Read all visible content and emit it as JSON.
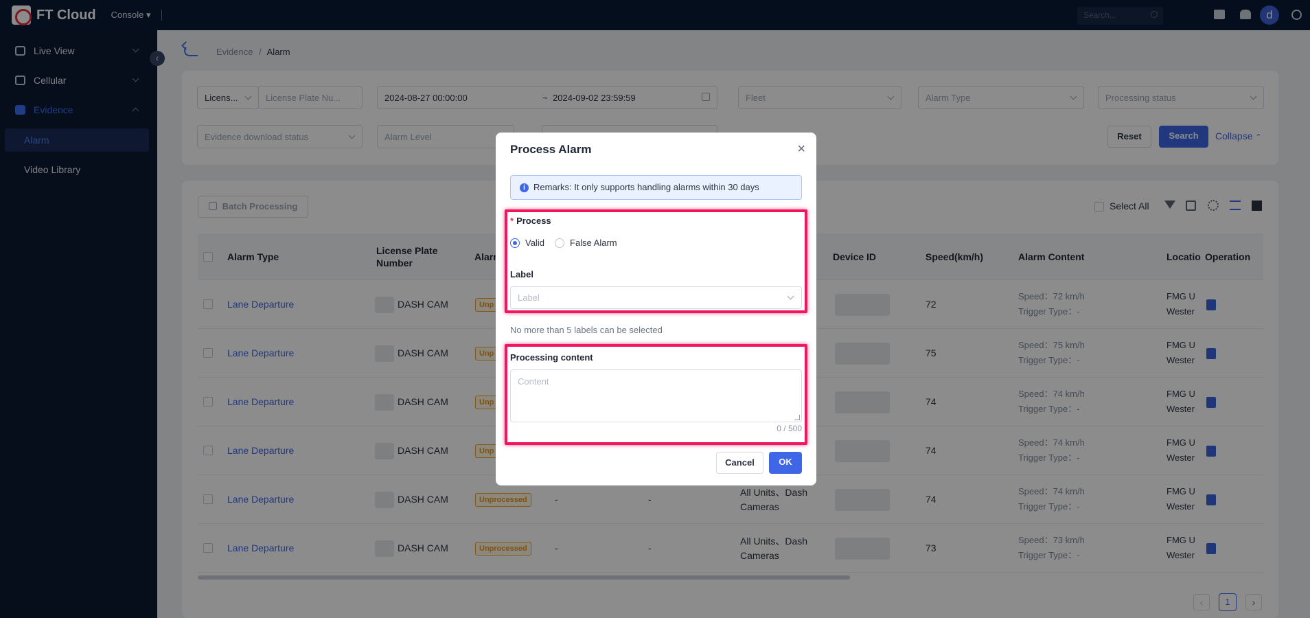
{
  "topbar": {
    "brand": "FT Cloud",
    "console_label": "Console",
    "search_placeholder": "Search...",
    "avatar_letter": "d"
  },
  "sidebar": {
    "items": [
      {
        "label": "Live View"
      },
      {
        "label": "Cellular"
      },
      {
        "label": "Evidence"
      }
    ],
    "subitems": [
      {
        "label": "Alarm"
      },
      {
        "label": "Video Library"
      }
    ]
  },
  "breadcrumb": {
    "parent": "Evidence",
    "separator": "/",
    "current": "Alarm"
  },
  "filters": {
    "plate_type": "Licens...",
    "plate_placeholder": "License Plate Nu...",
    "start_date": "2024-08-27 00:00:00",
    "range_sep": "~",
    "end_date": "2024-09-02 23:59:59",
    "fleet_placeholder": "Fleet",
    "alarm_type_placeholder": "Alarm Type",
    "processing_status_placeholder": "Processing status",
    "evidence_download_placeholder": "Evidence download status",
    "alarm_level_placeholder": "Alarm Level",
    "reset_label": "Reset",
    "search_label": "Search",
    "collapse_label": "Collapse"
  },
  "toolbar": {
    "batch_label": "Batch Processing",
    "select_all_label": "Select All"
  },
  "table": {
    "columns": {
      "alarm_type": "Alarm Type",
      "license_plate": "License Plate Number",
      "alarm_partial": "Alarm",
      "device_id": "Device ID",
      "speed": "Speed(km/h)",
      "alarm_content": "Alarm Content",
      "location": "Locatio",
      "operation": "Operation"
    },
    "rows": [
      {
        "alarm_type": "Lane Departure",
        "plate": "DASH CAM",
        "status": "Unp",
        "speed": "72",
        "content_speed": "Speed：72 km/h",
        "trigger": "Trigger Type：-",
        "loc1": "FMG U",
        "loc2": "Wester"
      },
      {
        "alarm_type": "Lane Departure",
        "plate": "DASH CAM",
        "status": "Unp",
        "speed": "75",
        "content_speed": "Speed：75 km/h",
        "trigger": "Trigger Type：-",
        "loc1": "FMG U",
        "loc2": "Wester"
      },
      {
        "alarm_type": "Lane Departure",
        "plate": "DASH CAM",
        "status": "Unp",
        "speed": "74",
        "content_speed": "Speed：74 km/h",
        "trigger": "Trigger Type：-",
        "loc1": "FMG U",
        "loc2": "Wester"
      },
      {
        "alarm_type": "Lane Departure",
        "plate": "DASH CAM",
        "status": "Unp",
        "speed": "74",
        "content_speed": "Speed：74 km/h",
        "trigger": "Trigger Type：-",
        "loc1": "FMG U",
        "loc2": "Wester"
      },
      {
        "alarm_type": "Lane Departure",
        "plate": "DASH CAM",
        "status": "Unprocessed",
        "c1": "-",
        "c2": "-",
        "fleet1": "All Units、Dash",
        "fleet2": "Cameras",
        "speed": "74",
        "content_speed": "Speed：74 km/h",
        "trigger": "Trigger Type：-",
        "loc1": "FMG U",
        "loc2": "Wester"
      },
      {
        "alarm_type": "Lane Departure",
        "plate": "DASH CAM",
        "status": "Unprocessed",
        "c1": "-",
        "c2": "-",
        "fleet1": "All Units、Dash",
        "fleet2": "Cameras",
        "speed": "73",
        "content_speed": "Speed：73 km/h",
        "trigger": "Trigger Type：-",
        "loc1": "FMG U",
        "loc2": "Wester"
      }
    ]
  },
  "pagination": {
    "current": "1"
  },
  "modal": {
    "title": "Process Alarm",
    "close": "×",
    "notice": "Remarks: It only supports handling alarms within 30 days",
    "notice_icon": "i",
    "process_label": "Process",
    "required_mark": "*",
    "option_valid": "Valid",
    "option_false": "False Alarm",
    "label_label": "Label",
    "label_placeholder": "Label",
    "label_hint": "No more than 5 labels can be selected",
    "content_label": "Processing content",
    "content_placeholder": "Content",
    "counter": "0 / 500",
    "cancel_label": "Cancel",
    "ok_label": "OK"
  },
  "colors": {
    "accent": "#3f66e6",
    "highlight": "#f0175f",
    "warning": "#f0a020",
    "nav_bg": "#0b1a33"
  }
}
